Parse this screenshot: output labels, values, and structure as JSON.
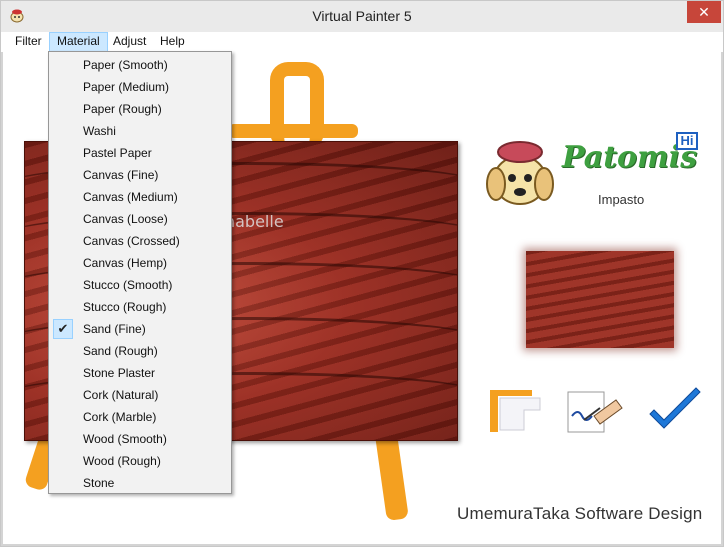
{
  "window": {
    "title": "Virtual Painter 5",
    "close_glyph": "✕"
  },
  "menubar": {
    "items": [
      "Filter",
      "Material",
      "Adjust",
      "Help"
    ],
    "active": "Material"
  },
  "material_menu": {
    "items": [
      "Paper (Smooth)",
      "Paper (Medium)",
      "Paper (Rough)",
      "Washi",
      "Pastel Paper",
      "Canvas (Fine)",
      "Canvas (Medium)",
      "Canvas (Loose)",
      "Canvas (Crossed)",
      "Canvas (Hemp)",
      "Stucco (Smooth)",
      "Stucco (Rough)",
      "Sand (Fine)",
      "Sand (Rough)",
      "Stone Plaster",
      "Cork (Natural)",
      "Cork (Marble)",
      "Wood (Smooth)",
      "Wood (Rough)",
      "Stone"
    ],
    "checked": "Sand (Fine)",
    "check_glyph": "✔"
  },
  "watermark": "©Animabelle",
  "logo": {
    "name": "Patomis",
    "badge": "Hi",
    "subtitle": "Impasto"
  },
  "buttons": {
    "frame": "frame-icon",
    "sign": "signature-icon",
    "ok": "checkmark-icon"
  },
  "brand": "UmemuraTaka Software Design",
  "colors": {
    "accent_orange": "#f4a020",
    "canvas_red": "#9a2a1e",
    "check_blue": "#1e78d8",
    "logo_green": "#3ea040"
  }
}
